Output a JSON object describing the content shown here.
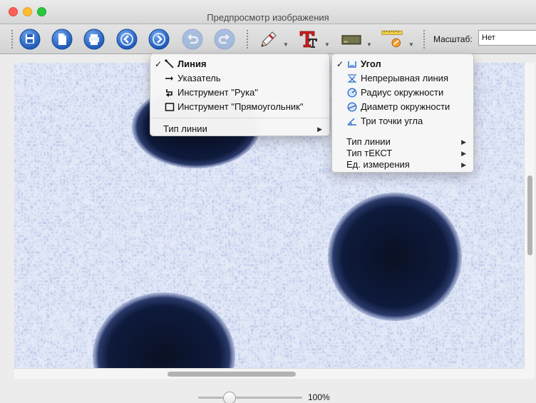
{
  "window": {
    "title": "Предпросмотр изображения"
  },
  "toolbar": {
    "zoom_label": "Масштаб:",
    "zoom_value": "Нет",
    "buttons": [
      "save-icon",
      "page-icon",
      "print-icon",
      "arrow-left-icon",
      "arrow-right-icon",
      "undo-icon",
      "redo-icon",
      "pencil-icon",
      "text-tool-icon",
      "color-box-icon",
      "ruler-icon"
    ]
  },
  "menu_left": {
    "items": [
      {
        "label": "Линия",
        "checked": true,
        "icon": "line-icon"
      },
      {
        "label": "Указатель",
        "icon": "pointer-arrow-icon"
      },
      {
        "label": "Инструмент \"Рука\"",
        "icon": "hand-tool-icon"
      },
      {
        "label": "Инструмент \"Прямоугольник\"",
        "icon": "rectangle-icon"
      }
    ],
    "submenu": {
      "label": "Тип линии"
    }
  },
  "menu_right": {
    "items": [
      {
        "label": "Угол",
        "checked": true,
        "icon": "angle-icon"
      },
      {
        "label": "Непрерывная линия",
        "icon": "polyline-icon"
      },
      {
        "label": "Радиус окружности",
        "icon": "circle-radius-icon"
      },
      {
        "label": "Диаметр окружности",
        "icon": "circle-diameter-icon"
      },
      {
        "label": "Три точки угла",
        "icon": "three-point-angle-icon"
      }
    ],
    "submenus": [
      {
        "label": "Тип линии"
      },
      {
        "label": "Тип тЕКСТ"
      },
      {
        "label": "Ед. измерения"
      }
    ],
    "check_glyph": "✓",
    "submenu_glyph": "▶"
  },
  "statusbar": {
    "zoom_percent": "100%",
    "slider_level": 0.3
  },
  "colors": {
    "accent_blue": "#2a6fd0",
    "image_bg": "#b9c7e8",
    "hole": "#0c1632"
  }
}
